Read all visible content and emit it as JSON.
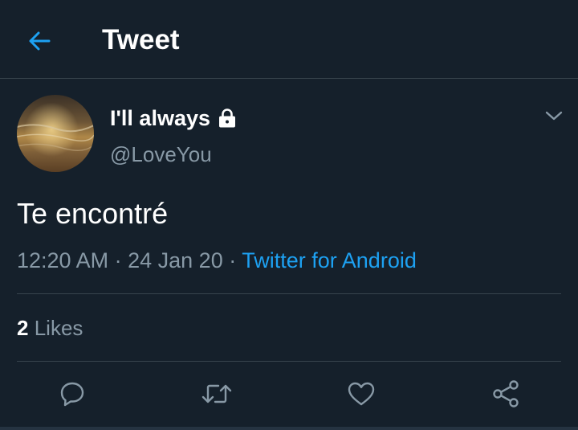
{
  "header": {
    "title": "Tweet",
    "back_icon": "arrow-left-icon"
  },
  "tweet": {
    "display_name": "I'll always",
    "protected_icon": "lock-icon",
    "handle": "@LoveYou",
    "text": "Te encontré",
    "time": "12:20 AM",
    "date": "24 Jan 20",
    "separator": "·",
    "source": "Twitter for Android",
    "likes_count": "2",
    "likes_label": "Likes"
  },
  "actions": {
    "reply": "reply-icon",
    "retweet": "retweet-icon",
    "like": "heart-icon",
    "share": "share-icon"
  },
  "colors": {
    "background": "#15202b",
    "accent": "#1da1f2",
    "secondary_text": "#8899a6",
    "divider": "#38444d"
  }
}
